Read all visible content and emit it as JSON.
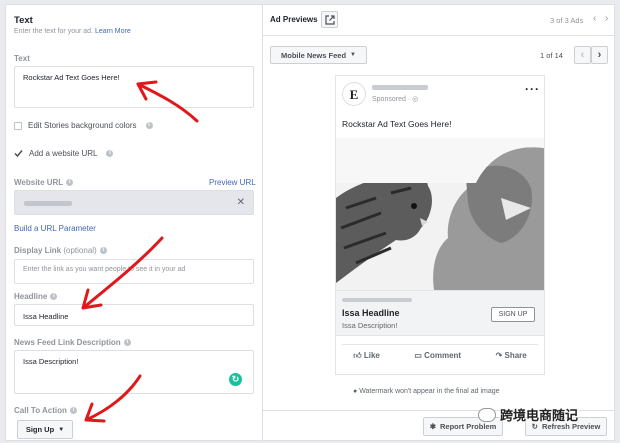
{
  "left_panel": {
    "title": "Text",
    "subtitle": "Enter the text for your ad.",
    "learn_more": "Learn More",
    "text_label": "Text",
    "text_value": "Rockstar Ad Text Goes Here!",
    "edit_stories_label": "Edit Stories background colors",
    "add_website_label": "Add a website URL",
    "website_url_label": "Website URL",
    "preview_url": "Preview URL",
    "build_url_param": "Build a URL Parameter",
    "display_link_label": "Display Link",
    "display_link_optional": "(optional)",
    "display_link_placeholder": "Enter the link as you want people to see it in your ad",
    "headline_label": "Headline",
    "headline_value": "Issa Headline",
    "newsfeed_desc_label": "News Feed Link Description",
    "newsfeed_desc_value": "Issa Description!",
    "cta_label": "Call To Action",
    "cta_value": "Sign Up"
  },
  "right_panel": {
    "title": "Ad Previews",
    "ads_count": "3 of 3 Ads",
    "placement": "Mobile News Feed",
    "page_count": "1 of 14",
    "ad": {
      "sponsored": "Sponsored",
      "primary_text": "Rockstar Ad Text Goes Here!",
      "headline": "Issa Headline",
      "description": "Issa Description!",
      "cta": "SIGN UP",
      "like": "Like",
      "comment": "Comment",
      "share": "Share"
    },
    "watermark_note": "Watermark won't appear in the final ad image",
    "report_problem": "Report Problem",
    "refresh_preview": "Refresh Preview"
  },
  "watermark_text": "跨境电商随记",
  "colors": {
    "accent": "#4267b2",
    "arrow": "#e0181c",
    "grammarly": "#15c39a"
  }
}
